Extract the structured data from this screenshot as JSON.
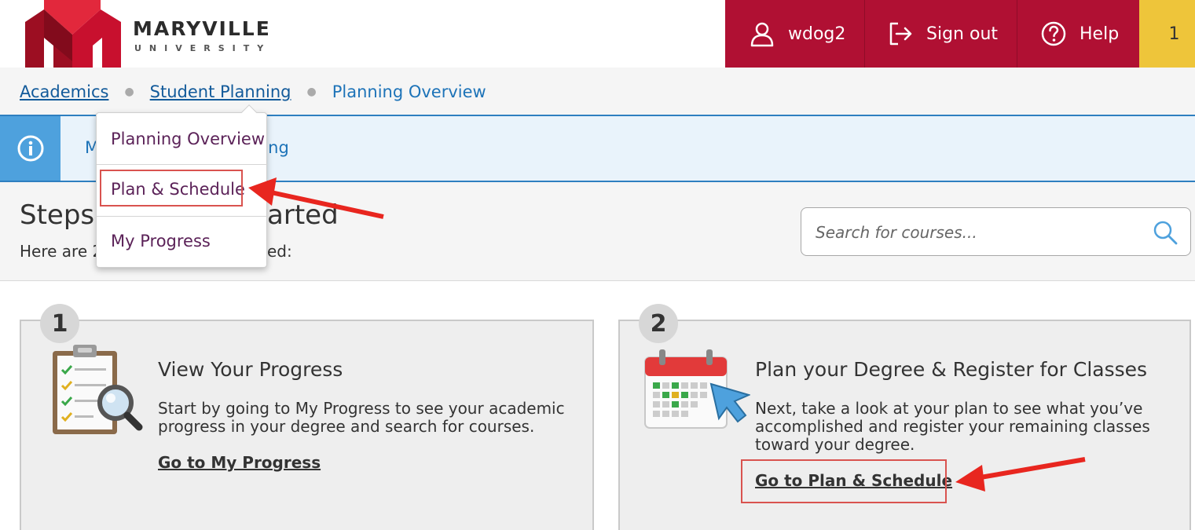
{
  "header": {
    "logo_name": "MARYVILLE",
    "logo_sub": "UNIVERSITY",
    "username": "wdog2",
    "sign_out_label": "Sign out",
    "help_label": "Help",
    "notification_count": "1",
    "brand_color": "#b01033",
    "notify_color": "#eec53a"
  },
  "breadcrumb": {
    "items": [
      "Academics",
      "Student Planning"
    ],
    "current": "Planning Overview"
  },
  "banner": {
    "text_left": "M",
    "text_right": "ning"
  },
  "dropdown": {
    "items": [
      "Planning Overview",
      "Plan & Schedule",
      "My Progress"
    ]
  },
  "steps": {
    "title_left": "Steps",
    "title_right": "arted",
    "sub_left": "Here are 2",
    "sub_right": "ed:"
  },
  "search": {
    "placeholder": "Search for courses..."
  },
  "cards": [
    {
      "number": "1",
      "title": "View Your Progress",
      "desc": "Start by going to My Progress to see your academic progress in your degree and search for courses.",
      "link": "Go to My Progress",
      "icon": "clipboard-checklist-icon"
    },
    {
      "number": "2",
      "title": "Plan your Degree & Register for Classes",
      "desc": "Next, take a look at your plan to see what you’ve accomplished and register your remaining classes toward your degree.",
      "link": "Go to Plan & Schedule",
      "icon": "calendar-icon"
    }
  ],
  "annotation_color": "#e8261f"
}
